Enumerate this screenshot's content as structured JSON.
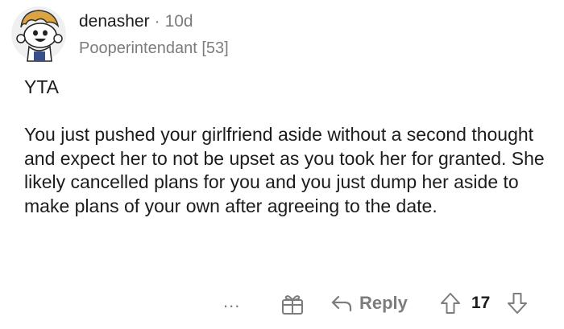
{
  "comment": {
    "username": "denasher",
    "separator": "·",
    "age": "10d",
    "flair": "Pooperintendant [53]",
    "verdict": "YTA",
    "body": "You just pushed your girlfriend aside without a second thought and expect her to not be upset as you took her for granted. She likely cancelled plans for you and you just dump her aside to make plans of your own after agreeing to the date."
  },
  "actions": {
    "more_label": "...",
    "reply_label": "Reply",
    "score": "17"
  },
  "icons": {
    "avatar": "snoo-avatar-icon",
    "award": "award-gift-icon",
    "reply": "reply-arrow-icon",
    "upvote": "upvote-arrow-icon",
    "downvote": "downvote-arrow-icon"
  },
  "colors": {
    "text_primary": "#1c1c1c",
    "text_secondary": "#7c7c7c",
    "background": "#ffffff"
  }
}
